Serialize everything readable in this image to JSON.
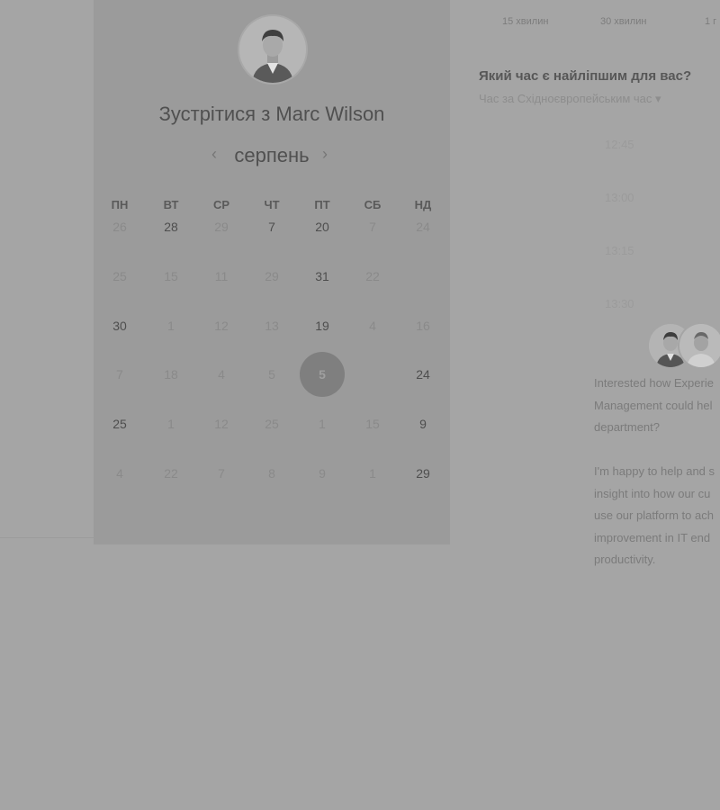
{
  "host": {
    "meeting_title": "Зустрітися з Marc Wilson",
    "avatar": "host-avatar"
  },
  "calendar": {
    "month": "серпень",
    "prev_icon": "chevron-left-icon",
    "next_icon": "chevron-right-icon",
    "weekdays": [
      "ПН",
      "ВТ",
      "СР",
      "ЧТ",
      "ПТ",
      "СБ",
      "НД"
    ],
    "weeks": [
      [
        {
          "d": "26",
          "a": false
        },
        {
          "d": "28",
          "a": true
        },
        {
          "d": "29",
          "a": false
        },
        {
          "d": "7",
          "a": true
        },
        {
          "d": "20",
          "a": true
        },
        {
          "d": "7",
          "a": false
        },
        {
          "d": "24",
          "a": false
        }
      ],
      [
        {
          "d": "25",
          "a": false
        },
        {
          "d": "15",
          "a": false
        },
        {
          "d": "11",
          "a": false
        },
        {
          "d": "29",
          "a": false
        },
        {
          "d": "31",
          "a": true
        },
        {
          "d": "22",
          "a": false
        },
        {
          "d": "",
          "a": false
        }
      ],
      [
        {
          "d": "30",
          "a": true
        },
        {
          "d": "1",
          "a": false
        },
        {
          "d": "12",
          "a": false
        },
        {
          "d": "13",
          "a": false
        },
        {
          "d": "19",
          "a": true
        },
        {
          "d": "4",
          "a": false
        },
        {
          "d": "16",
          "a": false
        }
      ],
      [
        {
          "d": "7",
          "a": false
        },
        {
          "d": "18",
          "a": false
        },
        {
          "d": "4",
          "a": false
        },
        {
          "d": "5",
          "a": false
        },
        {
          "d": "5",
          "a": true,
          "selected": true
        },
        {
          "d": "",
          "a": false
        },
        {
          "d": "24",
          "a": true
        }
      ],
      [
        {
          "d": "25",
          "a": true
        },
        {
          "d": "1",
          "a": false
        },
        {
          "d": "12",
          "a": false
        },
        {
          "d": "25",
          "a": false
        },
        {
          "d": "1",
          "a": false
        },
        {
          "d": "15",
          "a": false
        },
        {
          "d": "9",
          "a": true
        }
      ],
      [
        {
          "d": "4",
          "a": false
        },
        {
          "d": "22",
          "a": false
        },
        {
          "d": "7",
          "a": false
        },
        {
          "d": "8",
          "a": false
        },
        {
          "d": "9",
          "a": false
        },
        {
          "d": "1",
          "a": false
        },
        {
          "d": "29",
          "a": true
        }
      ]
    ]
  },
  "durations": [
    "15 хвилин",
    "30 хвилин",
    "1 г"
  ],
  "time_question": "Який час є найліпшим для вас?",
  "timezone_label": "Час за Східноєвропейським час ▾",
  "time_slots": [
    "12:45",
    "13:00",
    "13:15",
    "13:30"
  ],
  "info_lines": [
    "Interested how Experie",
    "Management could hel",
    "department?",
    "",
    "I'm happy to help and s",
    "insight into how our cu",
    "use our platform to ach",
    "improvement in IT end",
    "productivity."
  ]
}
